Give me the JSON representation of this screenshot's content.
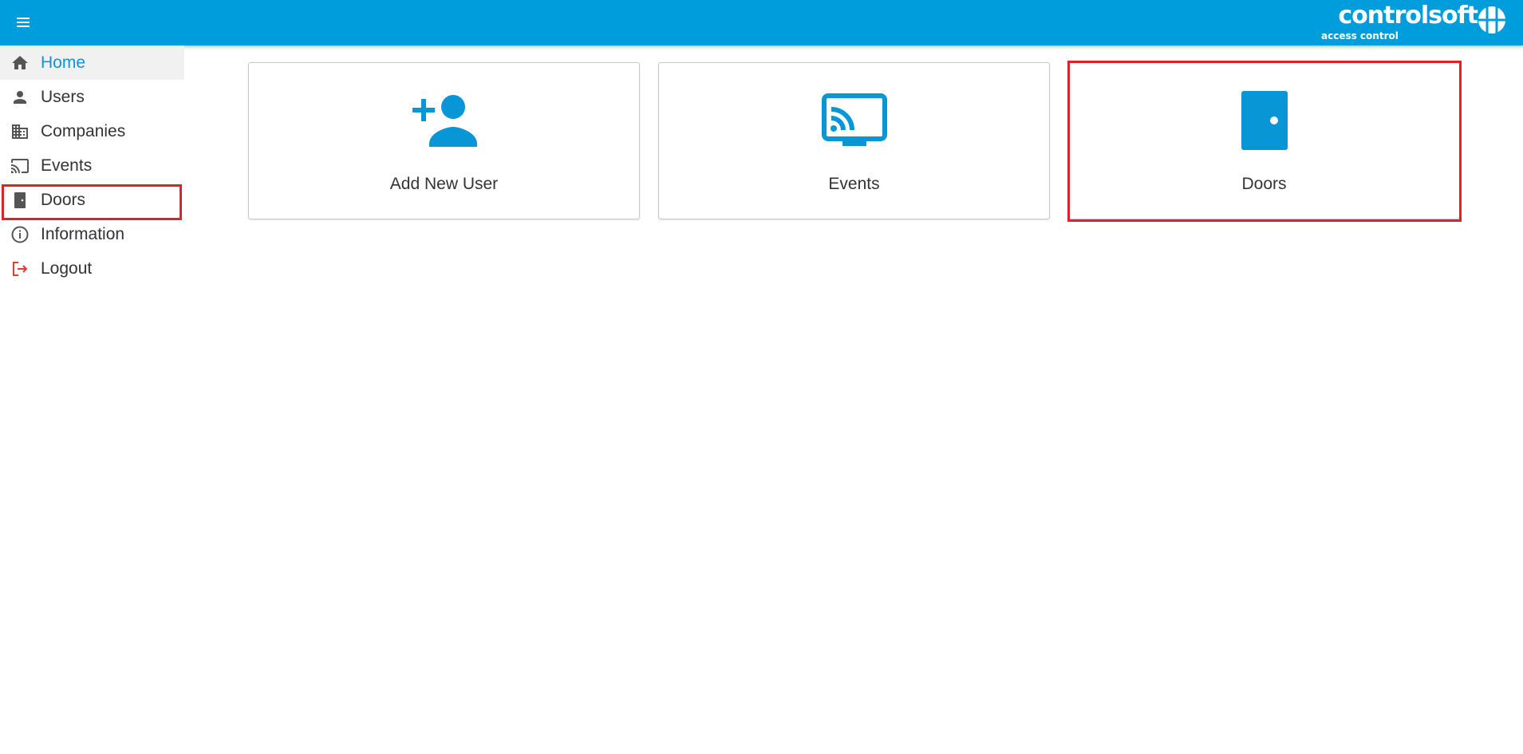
{
  "header": {
    "menu_icon": "hamburger-menu-icon",
    "logo": {
      "name": "controlsoft",
      "tagline": "access control",
      "registered": "®",
      "mark_icon": "controlsoft-grid-logo"
    },
    "bar_color": "#009ddc"
  },
  "sidebar": {
    "items": [
      {
        "label": "Home",
        "icon": "home-icon",
        "active": true
      },
      {
        "label": "Users",
        "icon": "person-icon"
      },
      {
        "label": "Companies",
        "icon": "building-icon"
      },
      {
        "label": "Events",
        "icon": "cast-icon"
      },
      {
        "label": "Doors",
        "icon": "door-icon"
      },
      {
        "label": "Information",
        "icon": "info-icon"
      },
      {
        "label": "Logout",
        "icon": "logout-icon"
      }
    ]
  },
  "tiles": [
    {
      "label": "Add New User",
      "icon": "add-user-icon"
    },
    {
      "label": "Events",
      "icon": "cast-icon"
    },
    {
      "label": "Doors",
      "icon": "door-icon"
    }
  ],
  "colors": {
    "accent": "#0996d6",
    "highlight": "#e0202a",
    "logout": "#e53935",
    "icon_gray": "#555555"
  }
}
